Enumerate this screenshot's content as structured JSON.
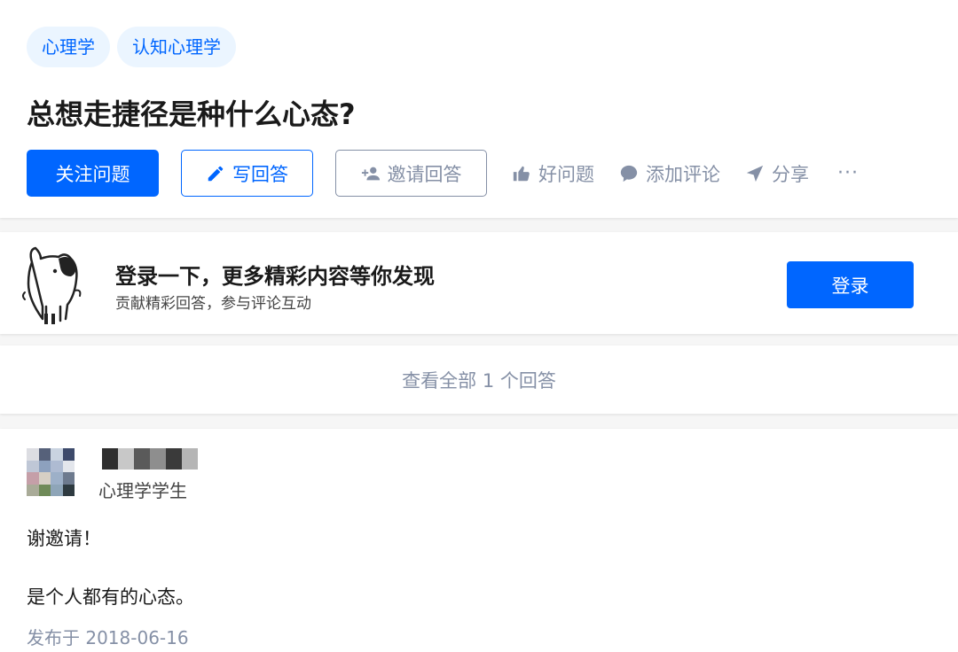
{
  "question": {
    "topics": [
      "心理学",
      "认知心理学"
    ],
    "title": "总想走捷径是种什么心态?",
    "actions": {
      "follow": "关注问题",
      "write_answer": "写回答",
      "invite": "邀请回答",
      "good_question": "好问题",
      "add_comment": "添加评论",
      "share": "分享",
      "more": "···"
    }
  },
  "login_prompt": {
    "title": "登录一下，更多精彩内容等你发现",
    "subtitle": "贡献精彩回答，参与评论互动",
    "button": "登录"
  },
  "view_all": {
    "label": "查看全部 1 个回答"
  },
  "answer": {
    "author_bio": "心理学学生",
    "paragraphs": [
      "谢邀请！",
      "是个人都有的心态。"
    ],
    "published": "发布于 2018-06-16"
  },
  "colors": {
    "accent": "#0066ff",
    "topic_bg": "#ebf5ff",
    "muted": "#8590a6"
  }
}
